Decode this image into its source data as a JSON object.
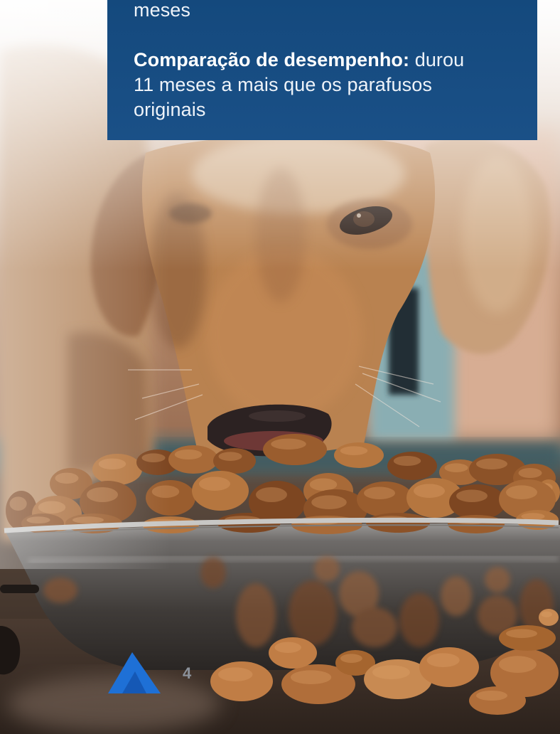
{
  "callout": {
    "prev_paragraph_tail": "meses",
    "comparison_label": "Comparação de desempenho:",
    "comparison_text": "durou 11 meses a mais que os parafusos originais"
  },
  "page": {
    "number": "4"
  },
  "logo": {
    "icon": "brand-logo-icon",
    "color": "#1e70d6"
  },
  "colors": {
    "callout_background": "#164c80",
    "callout_text": "#eef3f9",
    "page_number": "#8b919a"
  }
}
